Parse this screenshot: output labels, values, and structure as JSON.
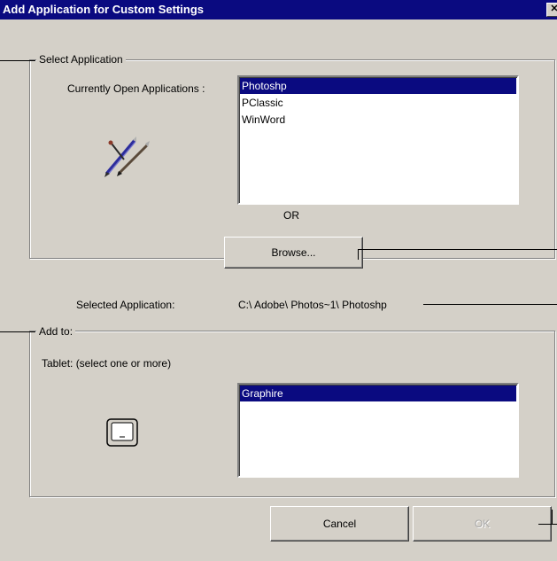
{
  "window": {
    "title": "Add Application for Custom Settings",
    "close_glyph": "✕"
  },
  "select_application": {
    "group_label": "Select Application",
    "open_apps_label": "Currently Open Applications :",
    "apps": [
      "Photoshp",
      "PClassic",
      "WinWord"
    ],
    "selected_app": "Photoshp",
    "or_label": "OR",
    "browse_label": "Browse..."
  },
  "selected_application": {
    "label": "Selected Application:",
    "value": "C:\\ Adobe\\ Photos~1\\ Photoshp"
  },
  "add_to": {
    "group_label": "Add to:",
    "tablet_label": "Tablet: (select one or more)",
    "tablets": [
      "Graphire"
    ],
    "selected_tablet": "Graphire"
  },
  "buttons": {
    "cancel_label": "Cancel",
    "ok_label": "OK",
    "ok_enabled": false
  },
  "icons": {
    "app_icon": "pens-icon",
    "tablet_icon": "tablet-icon"
  },
  "colors": {
    "titlebar": "#0a0a80",
    "selection": "#0a0a80",
    "face": "#d4d0c8"
  }
}
